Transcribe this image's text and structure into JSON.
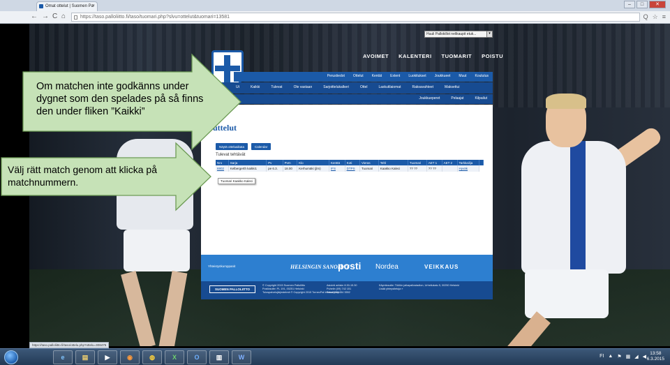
{
  "browser": {
    "tab_title": "Omat ottelut | Suomen Pa",
    "tab_close": "×",
    "url": "https://taso.palloliitto.fi/taso/tuomari.php?slvu=ottelut&tuomari=13581",
    "nav": {
      "back": "←",
      "forward": "→",
      "reload": "C",
      "home": "⌂"
    },
    "window_controls": {
      "minimize": "–",
      "maximize": "□",
      "close": "✕"
    },
    "addr_icons": {
      "search": "Q",
      "star": "☆",
      "menu": "≡"
    },
    "status_url": "https://taso.palloliitto.fi/taso/ottelu.php?ottelu=308475"
  },
  "site": {
    "team_select": "Huuli Pallokillot nelikaupit etuk...",
    "team_select_btn": "▾",
    "top_nav": [
      "AVOIMET",
      "KALENTERI",
      "TUOMARIT",
      "POISTU"
    ],
    "menu_row1": [
      "Perustiedot",
      "Ottelut",
      "Kentät",
      "Extent",
      "Luokitukset",
      "Joukkueet",
      "Muut",
      "Koulutus"
    ],
    "menu_row2": [
      "Ut",
      "Kaikki",
      "Tulevat",
      "Ole vastaan",
      "Sarjoittelukalkeri",
      "Ottel",
      "Laskutilaiomat",
      "Raksavahteet",
      "Maksettui"
    ],
    "menu_row3": [
      "Joukkueperet",
      "Pelaajat",
      "Kilpailut"
    ]
  },
  "main": {
    "title": "uttelut",
    "buttons": [
      "Näytä otteluaikata",
      "Calendar"
    ],
    "section": "Tulevat tehtävät",
    "columns": [
      "Nro",
      "Sarja",
      "Pv",
      "Pvm",
      "Klo",
      "Kenttä",
      "Koti",
      "Vieras",
      "Tehl",
      "Tuomari",
      "AET 1",
      "AET 2",
      "Tarkkailija",
      ""
    ],
    "rows": [
      [
        "6902",
        "Kelbergerth kaikki1",
        "pe 6.3.",
        "18.00",
        "Kerhumäki (jlm)",
        "IFS",
        "DTPS",
        "Tuomari",
        "Kaakko Kaleci",
        "?? ??",
        "?? ??",
        "",
        "Hyväk"
      ]
    ],
    "tooltip": "Tuomari Kaakko Kaleci"
  },
  "sponsors": {
    "label": "Yhteistyökumppanit",
    "items": [
      "HELSINGIN SANOMAT",
      "posti",
      "Nordea",
      "VEIKKAUS"
    ]
  },
  "footer": {
    "logo": "SUOMEN PALLOLIITTO",
    "copyright": "© Copyright 2015 Suomen Palloliitto\nPostiosoite: PL 191, 00251 Helsinki\nTulospalvelujärjestelmä © Copyright 2015 TorneoPal International",
    "contact": "Asiointi arkisin 8.30-15.30\nPuhelin (09) 742 151\nFaksi (09) 454 3352",
    "address": "Käyntiosoite: Töölön jalkapallostadion, Urheilukatu 5, 00250 Helsinki\nLisää yhteystietoja »"
  },
  "callouts": {
    "top": "Om matchen inte godkänns under dygnet som den spelades på  så finns den under fliken ”Kaikki”",
    "bottom": "Välj rätt match genom att klicka på matchnummern."
  },
  "taskbar": {
    "apps": [
      "e",
      "▤",
      "▶",
      "◉",
      "◍",
      "X",
      "O",
      "▥",
      "W"
    ],
    "tray": [
      "FI",
      "▲",
      "⚑",
      "▦",
      "◢",
      "◀"
    ],
    "time": "13:58",
    "date": "6.3.2015"
  }
}
